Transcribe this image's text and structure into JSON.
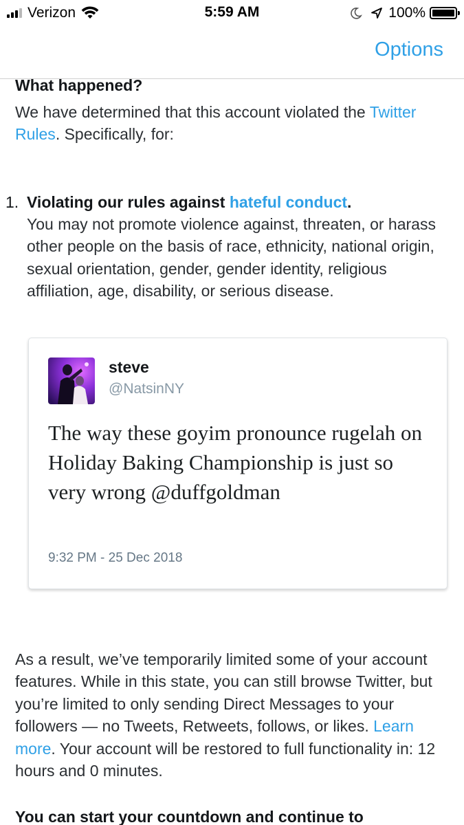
{
  "status_bar": {
    "carrier": "Verizon",
    "time": "5:59 AM",
    "battery": "100%",
    "battery_level": 1.0,
    "icons": [
      "signal-icon",
      "wifi-icon",
      "moon-icon",
      "location-icon",
      "battery-icon"
    ]
  },
  "nav": {
    "options_label": "Options"
  },
  "content": {
    "heading": "What happened?",
    "intro_text": "We have determined that this account violated the ",
    "twitter_rules_link": "Twitter Rules",
    "intro_suffix": ". Specifically, for:",
    "violation": {
      "number": "1.",
      "title_prefix": "Violating our rules against ",
      "title_link": "hateful conduct",
      "title_suffix": ".",
      "description": "You may not promote violence against, threaten, or harass other people on the basis of race, ethnicity, national origin, sexual orientation, gender, gender identity, religious affiliation, age, disability, or serious disease."
    },
    "tweet": {
      "name": "steve",
      "handle": "@NatsinNY",
      "text": "The way these goyim pronounce rugelah on Holiday Baking Championship is just so very wrong @duffgoldman",
      "timestamp": "9:32 PM - 25 Dec 2018"
    },
    "result": {
      "text_before": "As a result, we’ve temporarily limited some of your account features. While in this state, you can still browse Twitter, but you’re limited to only sending Direct Messages to your followers — no Tweets, Retweets, follows, or likes. ",
      "learn_more": "Learn more",
      "text_after": ". Your account will be restored to full functionality in: 12 hours and 0 minutes."
    },
    "countdown_text": "You can start your countdown and continue to"
  },
  "colors": {
    "link": "#2fa0e6",
    "text": "#14171a",
    "secondary": "#8899a6"
  }
}
